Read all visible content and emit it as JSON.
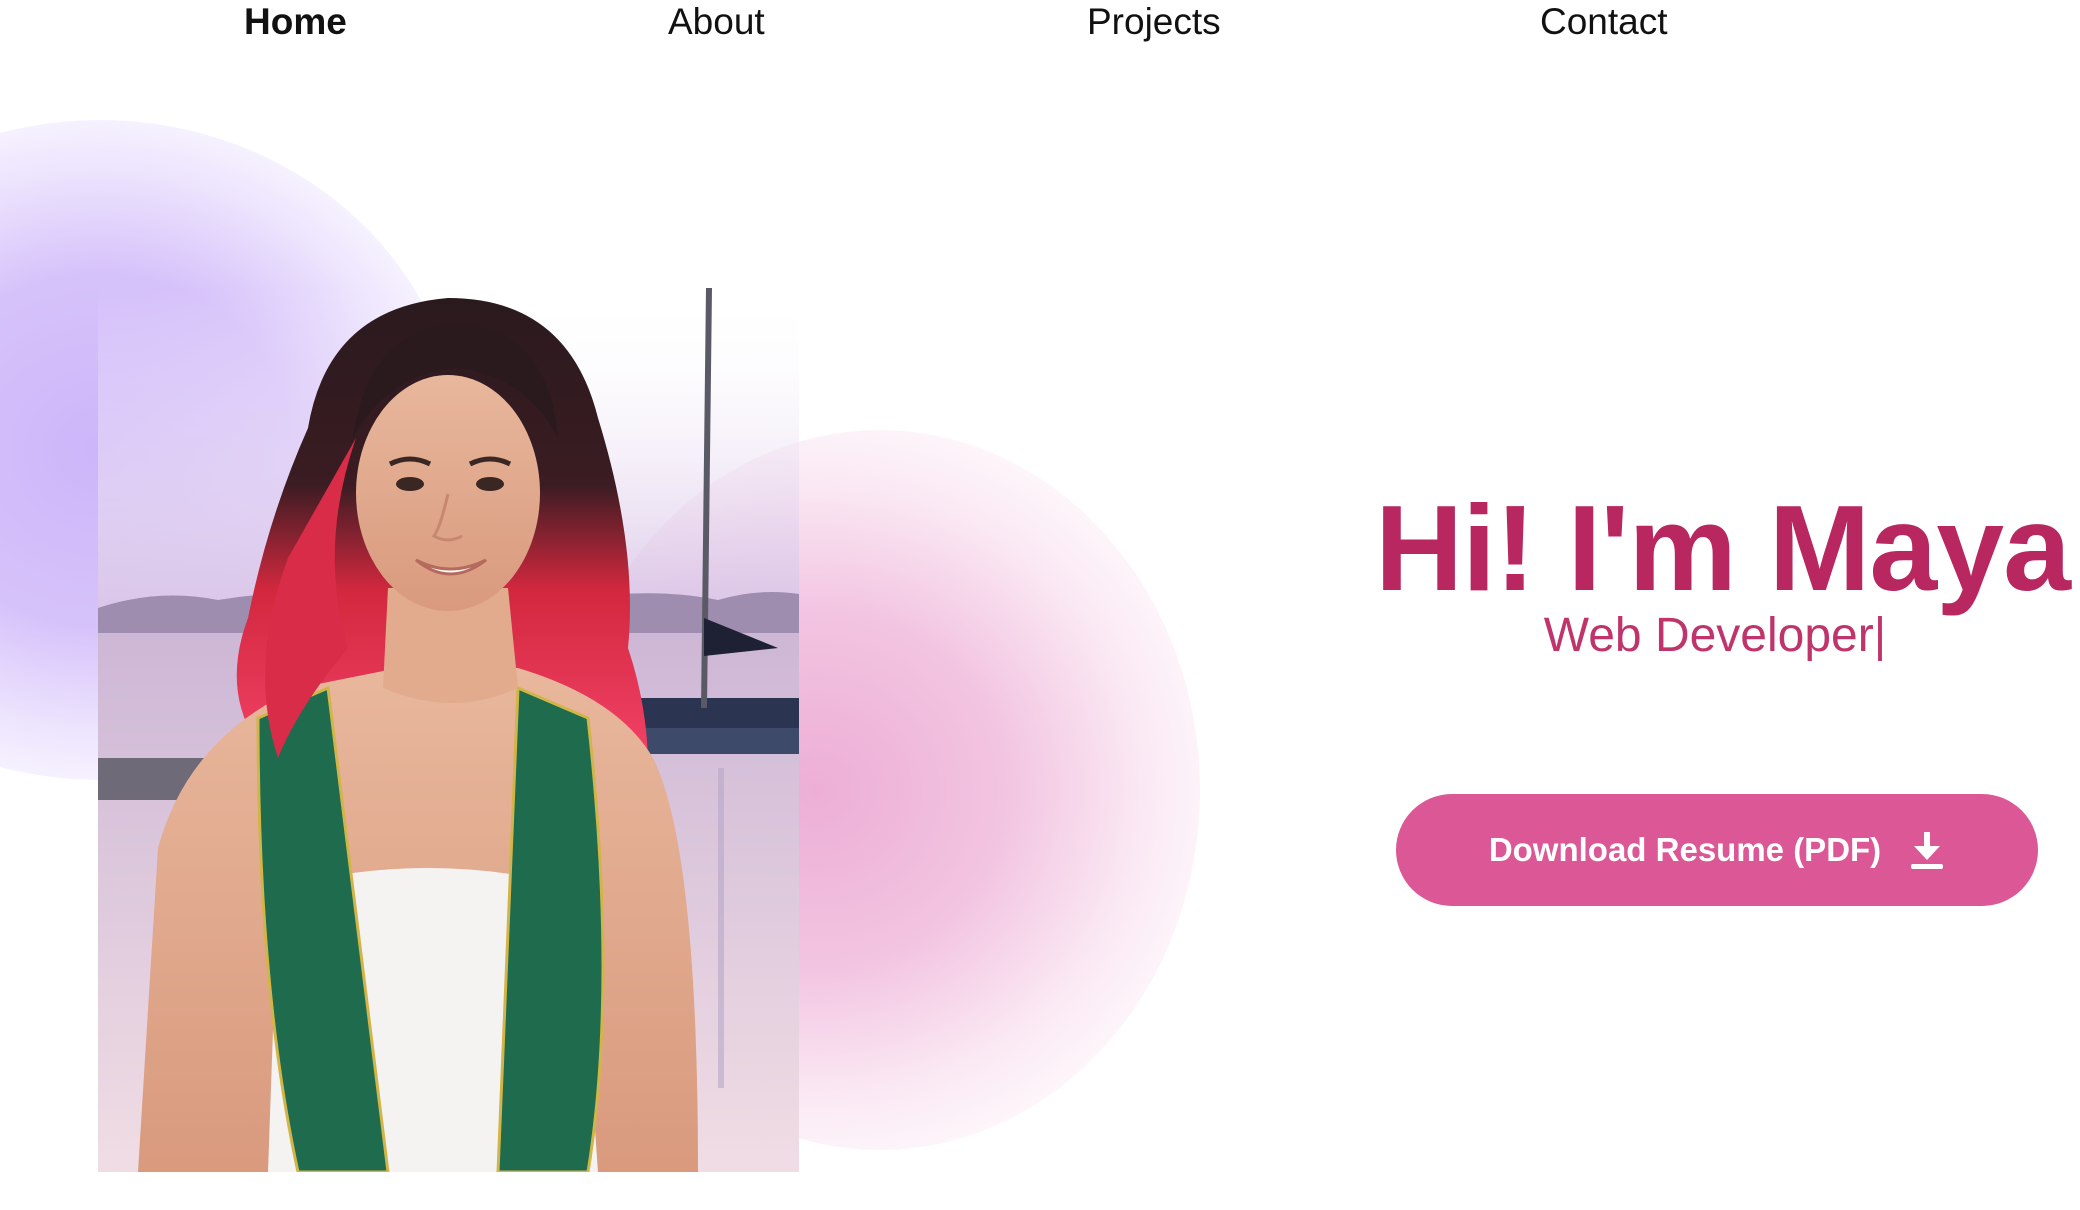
{
  "nav": {
    "items": [
      {
        "label": "Home",
        "active": true
      },
      {
        "label": "About",
        "active": false
      },
      {
        "label": "Projects",
        "active": false
      },
      {
        "label": "Contact",
        "active": false
      }
    ]
  },
  "hero": {
    "title": "Hi! I'm Maya",
    "subtitle": "Web Developer",
    "cursor": "|",
    "button_label": "Download Resume (PDF)",
    "button_icon": "download-icon"
  },
  "photo": {
    "subject_icon": "portrait-photo"
  },
  "colors": {
    "title": "#b8275f",
    "subtitle": "#c0346c",
    "button": "#dc5795",
    "blob_purple": "#ccb4fa",
    "blob_pink": "#ecaad4"
  }
}
